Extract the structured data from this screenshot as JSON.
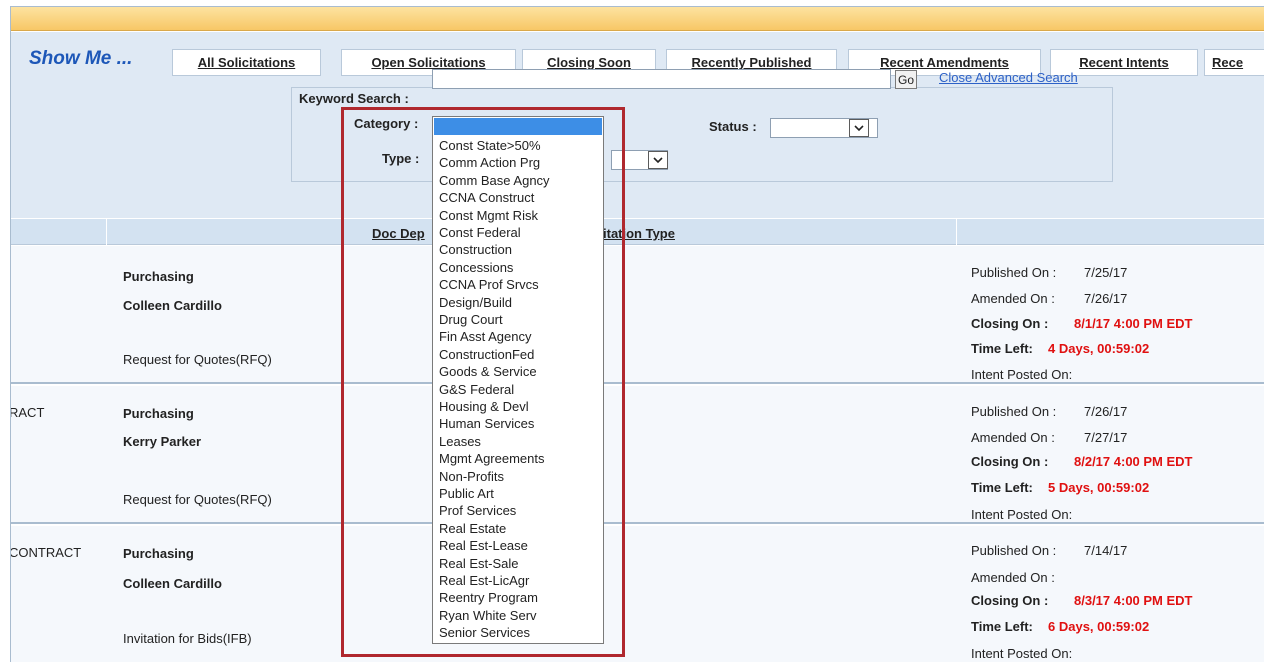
{
  "nav": {
    "show_me": "Show Me ...",
    "tabs": [
      {
        "label": "All Solicitations"
      },
      {
        "label": "Open Solicitations"
      },
      {
        "label": "Closing Soon"
      },
      {
        "label": "Recently Published"
      },
      {
        "label": "Recent Amendments"
      },
      {
        "label": "Recent Intents"
      },
      {
        "label": "Rece"
      }
    ]
  },
  "search": {
    "keyword_label": "Keyword Search :",
    "keyword_value": "",
    "go_label": "Go",
    "close_advanced": "Close Advanced Search",
    "category_label": "Category :",
    "status_label": "Status :",
    "type_label": "Type :"
  },
  "table": {
    "headers": {
      "doc_dept": "Doc Dep",
      "solicitation_type": "itation Type"
    },
    "rows": [
      {
        "title_fragment": "",
        "department": "Purchasing",
        "contact": "Colleen Cardillo",
        "solicitation_type": "Request for Quotes(RFQ)",
        "published_label": "Published On :",
        "published_value": "7/25/17",
        "amended_label": "Amended On :",
        "amended_value": "7/26/17",
        "closing_label": "Closing On :",
        "closing_value": "8/1/17 4:00 PM EDT",
        "time_left_label": "Time Left:",
        "time_left_value": "4 Days, 00:59:02",
        "intent_label": "Intent Posted On:"
      },
      {
        "title_fragment": "RACT",
        "department": "Purchasing",
        "contact": "Kerry Parker",
        "solicitation_type": "Request for Quotes(RFQ)",
        "published_label": "Published On :",
        "published_value": "7/26/17",
        "amended_label": "Amended On :",
        "amended_value": "7/27/17",
        "closing_label": "Closing On :",
        "closing_value": "8/2/17 4:00 PM EDT",
        "time_left_label": "Time Left:",
        "time_left_value": "5 Days, 00:59:02",
        "intent_label": "Intent Posted On:"
      },
      {
        "title_fragment": "CONTRACT",
        "department": "Purchasing",
        "contact": "Colleen Cardillo",
        "solicitation_type": "Invitation for Bids(IFB)",
        "published_label": "Published On :",
        "published_value": "7/14/17",
        "amended_label": "Amended On :",
        "amended_value": "",
        "closing_label": "Closing On :",
        "closing_value": "8/3/17 4:00 PM EDT",
        "time_left_label": "Time Left:",
        "time_left_value": "6 Days, 00:59:02",
        "intent_label": "Intent Posted On:"
      }
    ]
  },
  "category_dropdown": {
    "selected": "",
    "options": [
      "Const State>50%",
      "Comm Action Prg",
      "Comm Base Agncy",
      "CCNA Construct",
      "Const Mgmt Risk",
      "Const Federal",
      "Construction",
      "Concessions",
      "CCNA Prof Srvcs",
      "Design/Build",
      "Drug Court",
      "Fin Asst Agency",
      "ConstructionFed",
      "Goods & Service",
      "G&S Federal",
      "Housing & Devl",
      "Human Services",
      "Leases",
      "Mgmt Agreements",
      "Non-Profits",
      "Public Art",
      "Prof Services",
      "Real Estate",
      "Real Est-Lease",
      "Real Est-Sale",
      "Real Est-LicAgr",
      "Reentry Program",
      "Ryan White Serv",
      "Senior Services"
    ]
  },
  "colors": {
    "accent": "#1d57b8",
    "highlight_border": "#b0282e",
    "alert_red": "#e01010",
    "selection_blue": "#3d8ee6"
  }
}
